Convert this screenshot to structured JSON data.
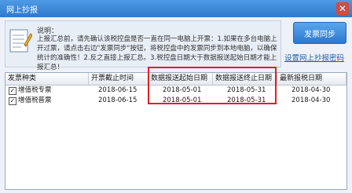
{
  "window": {
    "title": "网上抄报",
    "close_glyph": "✕"
  },
  "notes": {
    "label": "说明：",
    "text": "上报汇总前，请先确认该税控盘是否一直在同一电脑上开票：1.如果在多台电脑上开过票，请点击右边\"发票同步\"按钮，将税控盘中的发票同步到本地电脑，以确保统计的准确性！2.反之直接上报汇总。3.税控盘日期大于数据报送起始日期才能上报汇总！"
  },
  "toolbar": {
    "sync_label": "发票同步",
    "password_link": "设置网上抄报密码"
  },
  "table": {
    "columns": [
      "发票种类",
      "开票截止时间",
      "数据报送起始日期",
      "数据报送终止日期",
      "最新报税日期"
    ],
    "rows": [
      {
        "checked": true,
        "type": "增值税专票",
        "cutoff": "2018-06-15",
        "start": "2018-05-01",
        "end": "2018-05-31",
        "latest": "2018-04-30"
      },
      {
        "checked": true,
        "type": "增值税普票",
        "cutoff": "2018-06-15",
        "start": "2018-05-01",
        "end": "2018-05-31",
        "latest": "2018-04-30"
      }
    ]
  },
  "colors": {
    "titlebar": "#2f79cc",
    "highlight": "#e01f1f"
  }
}
